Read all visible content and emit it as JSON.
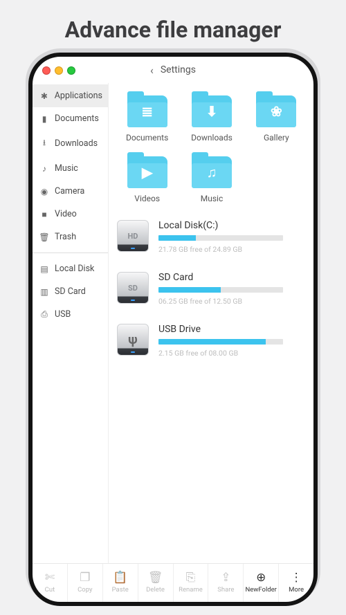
{
  "promo_title": "Advance file manager",
  "titlebar": {
    "back_label": "Settings"
  },
  "sidebar": {
    "groups": [
      {
        "items": [
          {
            "name": "applications",
            "label": "Applications",
            "icon": "✱",
            "active": true
          },
          {
            "name": "documents",
            "label": "Documents",
            "icon": "▮"
          },
          {
            "name": "downloads",
            "label": "Downloads",
            "icon": "⭳"
          },
          {
            "name": "music",
            "label": "Music",
            "icon": "♪"
          },
          {
            "name": "camera",
            "label": "Camera",
            "icon": "◉"
          },
          {
            "name": "video",
            "label": "Video",
            "icon": "■"
          },
          {
            "name": "trash",
            "label": "Trash",
            "icon": "🗑"
          }
        ]
      },
      {
        "items": [
          {
            "name": "local-disk",
            "label": "Local Disk",
            "icon": "▤"
          },
          {
            "name": "sd-card",
            "label": "SD Card",
            "icon": "▥"
          },
          {
            "name": "usb",
            "label": "USB",
            "icon": "⎙"
          }
        ]
      }
    ]
  },
  "folders": [
    {
      "name": "documents",
      "label": "Documents",
      "glyph": "≣"
    },
    {
      "name": "downloads",
      "label": "Downloads",
      "glyph": "⬇"
    },
    {
      "name": "gallery",
      "label": "Gallery",
      "glyph": "❀"
    },
    {
      "name": "videos",
      "label": "Videos",
      "glyph": "▶"
    },
    {
      "name": "music",
      "label": "Music",
      "glyph": "♫"
    }
  ],
  "drives": [
    {
      "name": "local-disk",
      "label": "Local Disk(C:)",
      "badge": "HD",
      "used_pct": 30,
      "free_text": "21.78 GB free of 24.89 GB"
    },
    {
      "name": "sd-card",
      "label": "SD Card",
      "badge": "SD",
      "used_pct": 50,
      "free_text": "06.25 GB free of 12.50 GB"
    },
    {
      "name": "usb-drive",
      "label": "USB Drive",
      "badge": "usb",
      "used_pct": 86,
      "free_text": "2.15 GB free of 08.00 GB"
    }
  ],
  "toolbar": [
    {
      "name": "cut",
      "label": "Cut",
      "icon": "✄"
    },
    {
      "name": "copy",
      "label": "Copy",
      "icon": "❐"
    },
    {
      "name": "paste",
      "label": "Paste",
      "icon": "📋"
    },
    {
      "name": "delete",
      "label": "Delete",
      "icon": "🗑"
    },
    {
      "name": "rename",
      "label": "Rename",
      "icon": "⎘"
    },
    {
      "name": "share",
      "label": "Share",
      "icon": "⇪"
    },
    {
      "name": "newfolder",
      "label": "NewFolder",
      "icon": "⊕",
      "dark": true
    },
    {
      "name": "more",
      "label": "More",
      "icon": "⋮",
      "dark": true
    }
  ]
}
